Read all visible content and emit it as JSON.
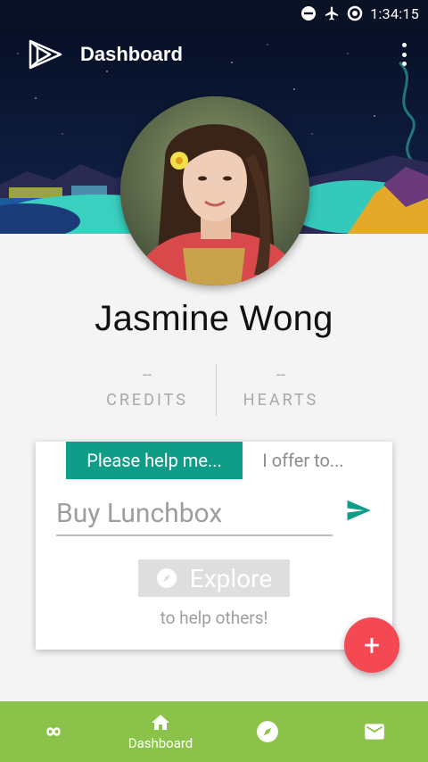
{
  "status_bar": {
    "time": "1:34:15",
    "icons": [
      "do-not-disturb-icon",
      "airplane-mode-icon",
      "data-saver-icon"
    ]
  },
  "app_bar": {
    "title": "Dashboard",
    "logo": "play-triangle-logo",
    "menu_icon": "more-vertical-icon"
  },
  "profile": {
    "name": "Jasmine Wong",
    "avatar": "profile-photo"
  },
  "stats": [
    {
      "value": "--",
      "label": "CREDITS"
    },
    {
      "value": "--",
      "label": "HEARTS"
    }
  ],
  "card": {
    "tabs": [
      {
        "label": "Please help me...",
        "active": true
      },
      {
        "label": "I offer to...",
        "active": false
      }
    ],
    "input": {
      "value": "",
      "placeholder": "Buy Lunchbox"
    },
    "send_icon": "send-icon",
    "explore_button": {
      "label": "Explore",
      "icon": "compass-icon"
    },
    "hint": "to help others!"
  },
  "fab": {
    "label": "+",
    "icon": "add-icon"
  },
  "bottom_nav": {
    "items": [
      {
        "label": "",
        "icon": "infinity-icon"
      },
      {
        "label": "Dashboard",
        "icon": "home-icon",
        "active": true
      },
      {
        "label": "",
        "icon": "compass-icon"
      },
      {
        "label": "",
        "icon": "mail-icon"
      }
    ]
  },
  "colors": {
    "accent": "#0f9d87",
    "nav": "#8bc34a",
    "fab": "#f44952",
    "hero": "#0d1a3a"
  }
}
